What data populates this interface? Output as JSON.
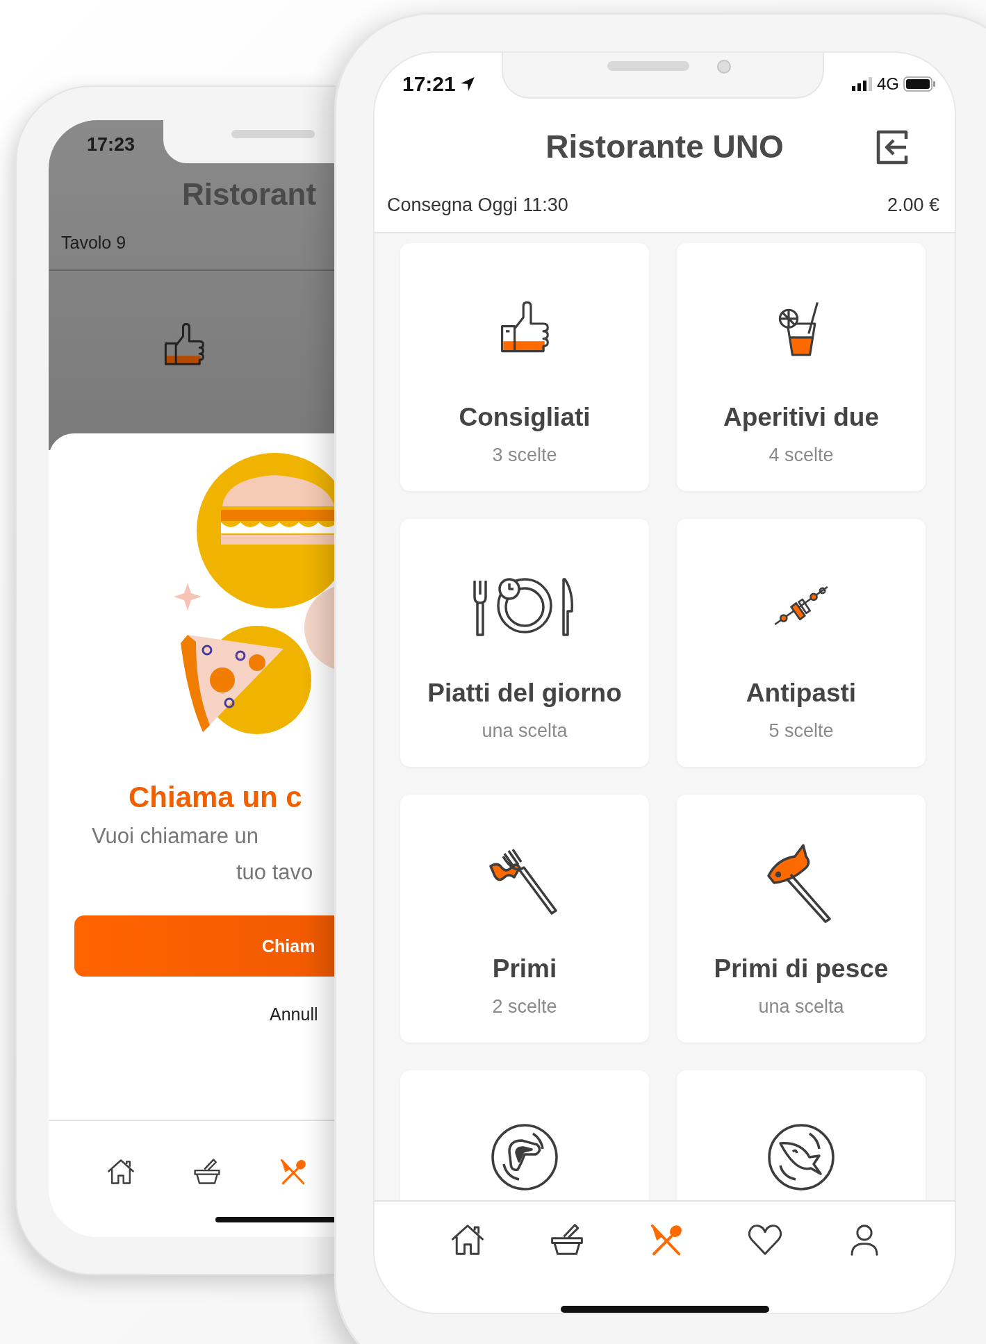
{
  "back_phone": {
    "status_time": "17:23",
    "title": "Ristorant",
    "table": "Tavolo 9",
    "dialog": {
      "title": "Chiama un c",
      "message_lines": [
        "Vuoi chiamare un",
        "tuo tavo"
      ],
      "confirm": "Chiam",
      "cancel": "Annull"
    },
    "tab_bar": [
      {
        "kind": "home",
        "selected": false
      },
      {
        "kind": "basket",
        "selected": false
      },
      {
        "kind": "cutlery",
        "selected": true
      }
    ]
  },
  "front_phone": {
    "status_time": "17:21",
    "network": "4G",
    "title": "Ristorante UNO",
    "delivery": "Consegna Oggi 11:30",
    "price": "2.00 €",
    "categories": [
      {
        "kind": "thumb",
        "name": "Consigliati",
        "count": "3 scelte"
      },
      {
        "kind": "cocktail",
        "name": "Aperitivi due",
        "count": "4 scelte"
      },
      {
        "kind": "plate-cutlery",
        "name": "Piatti del giorno",
        "count": "una scelta"
      },
      {
        "kind": "skewer",
        "name": "Antipasti",
        "count": "5 scelte"
      },
      {
        "kind": "fork-pasta",
        "name": "Primi",
        "count": "2 scelte"
      },
      {
        "kind": "fork-fish",
        "name": "Primi di pesce",
        "count": "una scelta"
      },
      {
        "kind": "meat-plate"
      },
      {
        "kind": "fish-plate"
      }
    ],
    "tab_bar": [
      {
        "kind": "home",
        "selected": false
      },
      {
        "kind": "basket",
        "selected": false
      },
      {
        "kind": "cutlery",
        "selected": true
      },
      {
        "kind": "heart",
        "selected": false
      },
      {
        "kind": "person",
        "selected": false
      }
    ]
  }
}
